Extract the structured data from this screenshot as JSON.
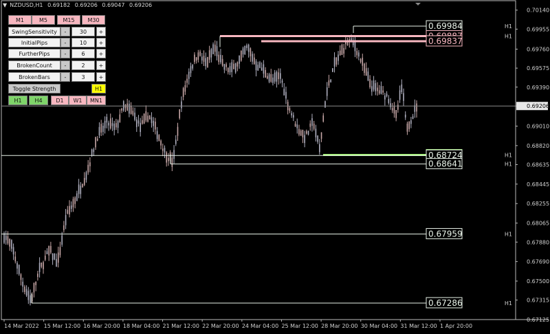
{
  "header": {
    "symbol": "NZDUSD,H1",
    "quotes": [
      "0.69182",
      "0.69206",
      "0.69047",
      "0.69206"
    ]
  },
  "panel": {
    "tf_row1": [
      "M1",
      "M5",
      "M15",
      "M30"
    ],
    "params": [
      {
        "label": "SwingSensitivity",
        "minus": "-",
        "value": "30",
        "plus": "+"
      },
      {
        "label": "InitialPips",
        "minus": "-",
        "value": "10",
        "plus": "+"
      },
      {
        "label": "FurtherPips",
        "minus": "-",
        "value": "6",
        "plus": "+"
      },
      {
        "label": "BrokenCount",
        "minus": "-",
        "value": "2",
        "plus": "+"
      },
      {
        "label": "BrokenBars",
        "minus": "-",
        "value": "3",
        "plus": "+"
      }
    ],
    "toggle_label": "Toggle Strength",
    "toggle_tf": "H1",
    "tf_row2": [
      "H1",
      "H4",
      "D1",
      "W1",
      "MN1"
    ],
    "tf_row2_active": [
      "H1",
      "H4"
    ]
  },
  "colors": {
    "background": "#000000",
    "candle": "#9a9aa8",
    "candle_bull": "#b0b0c0",
    "candle_bear": "#c8a8a8",
    "level_white": "#e8f2e8",
    "level_pink": "#f7b7c0",
    "level_green": "#a6f27a",
    "axis_text": "#d0d0d0",
    "price_marker_bg": "#e8e8e8"
  },
  "chart_data": {
    "type": "candlestick",
    "symbol": "NZDUSD",
    "timeframe": "H1",
    "ylim": [
      0.67125,
      0.70145
    ],
    "y_ticks": [
      "0.70140",
      "0.69955",
      "0.69760",
      "0.69575",
      "0.69390",
      "0.69206",
      "0.69010",
      "0.68820",
      "0.68635",
      "0.68445",
      "0.68255",
      "0.68065",
      "0.67880",
      "0.67690",
      "0.67500",
      "0.67315",
      "0.67125"
    ],
    "current_price": "0.69206",
    "x_ticks": [
      "14 Mar 2022",
      "15 Mar 12:00",
      "16 Mar 20:00",
      "18 Mar 04:00",
      "21 Mar 12:00",
      "22 Mar 20:00",
      "24 Mar 04:00",
      "25 Mar 12:00",
      "28 Mar 20:00",
      "30 Mar 04:00",
      "31 Mar 12:00",
      "1 Apr 20:00"
    ],
    "path": [
      [
        0.0,
        0.6795
      ],
      [
        0.02,
        0.6782
      ],
      [
        0.045,
        0.6748
      ],
      [
        0.065,
        0.6731
      ],
      [
        0.085,
        0.676
      ],
      [
        0.11,
        0.678
      ],
      [
        0.13,
        0.6768
      ],
      [
        0.15,
        0.6812
      ],
      [
        0.175,
        0.6832
      ],
      [
        0.2,
        0.6855
      ],
      [
        0.225,
        0.689
      ],
      [
        0.25,
        0.6905
      ],
      [
        0.27,
        0.6898
      ],
      [
        0.29,
        0.692
      ],
      [
        0.31,
        0.6915
      ],
      [
        0.33,
        0.69
      ],
      [
        0.35,
        0.6912
      ],
      [
        0.37,
        0.6896
      ],
      [
        0.39,
        0.6875
      ],
      [
        0.41,
        0.6866
      ],
      [
        0.43,
        0.6925
      ],
      [
        0.45,
        0.6955
      ],
      [
        0.47,
        0.6972
      ],
      [
        0.49,
        0.6962
      ],
      [
        0.51,
        0.6978
      ],
      [
        0.53,
        0.696
      ],
      [
        0.55,
        0.6955
      ],
      [
        0.57,
        0.6965
      ],
      [
        0.59,
        0.6978
      ],
      [
        0.61,
        0.6962
      ],
      [
        0.63,
        0.6955
      ],
      [
        0.65,
        0.6945
      ],
      [
        0.67,
        0.695
      ],
      [
        0.69,
        0.692
      ],
      [
        0.71,
        0.69
      ],
      [
        0.73,
        0.689
      ],
      [
        0.75,
        0.6905
      ],
      [
        0.765,
        0.6878
      ],
      [
        0.78,
        0.693
      ],
      [
        0.8,
        0.696
      ],
      [
        0.82,
        0.6975
      ],
      [
        0.835,
        0.6984
      ],
      [
        0.85,
        0.698
      ],
      [
        0.87,
        0.696
      ],
      [
        0.89,
        0.694
      ],
      [
        0.91,
        0.6935
      ],
      [
        0.93,
        0.693
      ],
      [
        0.95,
        0.691
      ],
      [
        0.965,
        0.694
      ],
      [
        0.975,
        0.69
      ],
      [
        0.99,
        0.691
      ],
      [
        1.0,
        0.6921
      ]
    ],
    "levels": [
      {
        "price": "0.69984",
        "value": 0.69984,
        "color": "white",
        "tf": "H1"
      },
      {
        "price": "0.69887",
        "value": 0.69887,
        "color": "pink",
        "tf": "H1"
      },
      {
        "price": "0.69837",
        "value": 0.69837,
        "color": "pink",
        "tf": ""
      },
      {
        "price": "0.68729",
        "value": 0.68729,
        "color": "green",
        "tf": "H1"
      },
      {
        "price": "0.68724",
        "value": 0.68724,
        "color": "white",
        "tf": ""
      },
      {
        "price": "0.68641",
        "value": 0.68641,
        "color": "white",
        "tf": "H1"
      },
      {
        "price": "0.67959",
        "value": 0.67959,
        "color": "white",
        "tf": "H1"
      },
      {
        "price": "0.67286",
        "value": 0.67286,
        "color": "white",
        "tf": "H1"
      }
    ]
  }
}
